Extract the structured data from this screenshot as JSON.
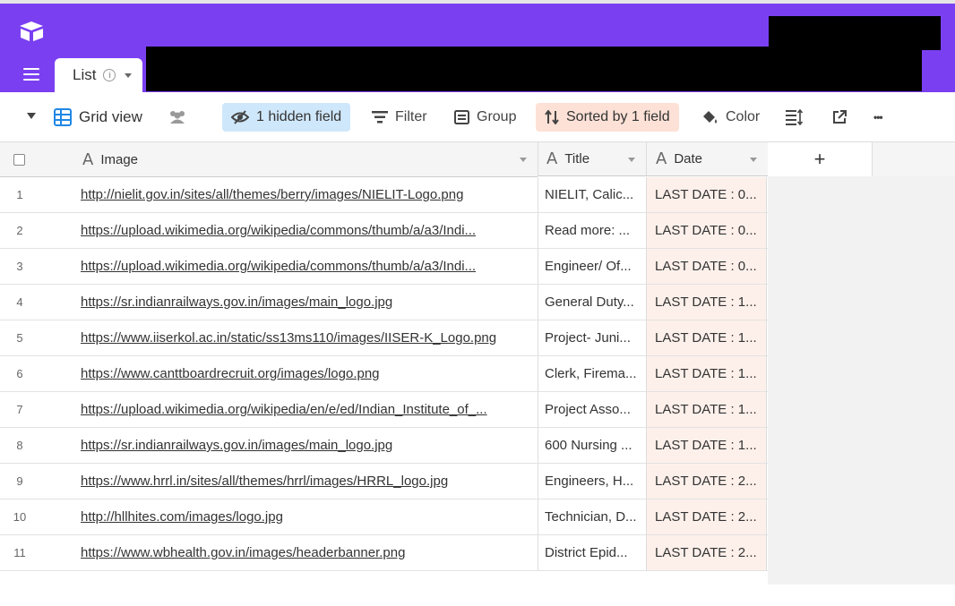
{
  "header": {
    "tab_label": "List",
    "info_icon": "i"
  },
  "toolbar": {
    "view_name": "Grid view",
    "hidden_fields": "1 hidden field",
    "filter": "Filter",
    "group": "Group",
    "sorted": "Sorted by 1 field",
    "color": "Color",
    "more": "•••"
  },
  "grid": {
    "columns": [
      {
        "name": "Image",
        "type_icon": "A"
      },
      {
        "name": "Title",
        "type_icon": "A"
      },
      {
        "name": "Date",
        "type_icon": "A"
      }
    ],
    "add_column": "+",
    "rows": [
      {
        "num": "1",
        "image": "http://nielit.gov.in/sites/all/themes/berry/images/NIELIT-Logo.png",
        "title": "NIELIT, Calic...",
        "date": "LAST DATE : 0..."
      },
      {
        "num": "2",
        "image": "https://upload.wikimedia.org/wikipedia/commons/thumb/a/a3/Indi...",
        "title": "Read more: ...",
        "date": "LAST DATE : 0..."
      },
      {
        "num": "3",
        "image": "https://upload.wikimedia.org/wikipedia/commons/thumb/a/a3/Indi...",
        "title": "Engineer/ Of...",
        "date": "LAST DATE : 0..."
      },
      {
        "num": "4",
        "image": "https://sr.indianrailways.gov.in/images/main_logo.jpg",
        "title": "General Duty...",
        "date": "LAST DATE : 1..."
      },
      {
        "num": "5",
        "image": "https://www.iiserkol.ac.in/static/ss13ms110/images/IISER-K_Logo.png",
        "title": "Project- Juni...",
        "date": "LAST DATE : 1..."
      },
      {
        "num": "6",
        "image": "https://www.canttboardrecruit.org/images/logo.png",
        "title": "Clerk, Firema...",
        "date": "LAST DATE : 1..."
      },
      {
        "num": "7",
        "image": "https://upload.wikimedia.org/wikipedia/en/e/ed/Indian_Institute_of_...",
        "title": "Project Asso...",
        "date": "LAST DATE : 1..."
      },
      {
        "num": "8",
        "image": "https://sr.indianrailways.gov.in/images/main_logo.jpg",
        "title": "600 Nursing ...",
        "date": "LAST DATE : 1..."
      },
      {
        "num": "9",
        "image": "https://www.hrrl.in/sites/all/themes/hrrl/images/HRRL_logo.jpg",
        "title": "Engineers, H...",
        "date": "LAST DATE : 2..."
      },
      {
        "num": "10",
        "image": "http://hllhites.com/images/logo.jpg",
        "title": "Technician, D...",
        "date": "LAST DATE : 2..."
      },
      {
        "num": "11",
        "image": "https://www.wbhealth.gov.in/images/headerbanner.png",
        "title": "District Epid...",
        "date": "LAST DATE : 2..."
      }
    ]
  },
  "colors": {
    "brand_purple": "#7b3ff2",
    "hidden_field_bg": "#cfe7fb",
    "sorted_bg": "#fde1d6",
    "sorted_column_bg": "#fdf0ea"
  }
}
